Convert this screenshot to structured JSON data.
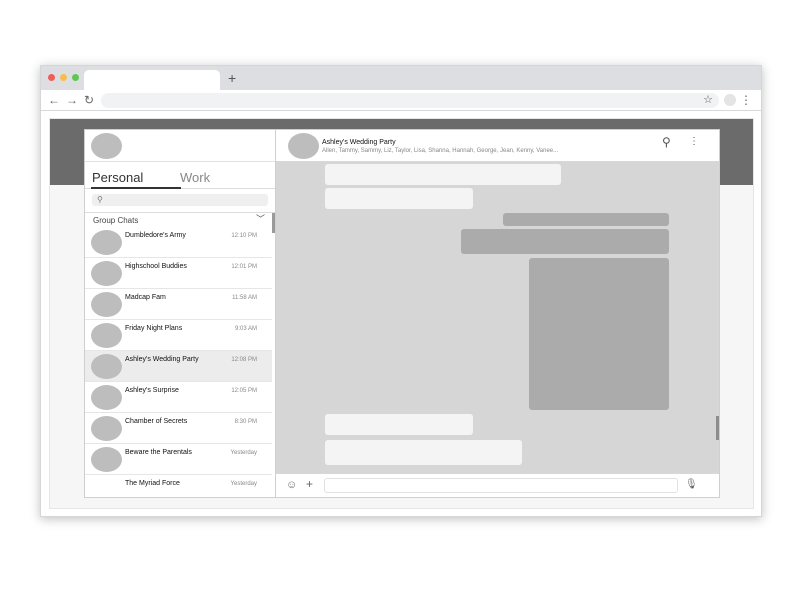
{
  "browser": {
    "dots": [
      "#ee5f57",
      "#f5bd4f",
      "#61c554"
    ],
    "new_tab": "+",
    "back": "←",
    "forward": "→",
    "reload": "↻",
    "star": "☆",
    "menu": "⋮"
  },
  "sidebar": {
    "tabs": {
      "personal": "Personal",
      "work": "Work"
    },
    "search_icon": "⚲",
    "group_label": "Group Chats",
    "chevron": "﹀",
    "chats": [
      {
        "name": "Dumbledore's Army",
        "time": "12:10 PM"
      },
      {
        "name": "Highschool Buddies",
        "time": "12:01 PM"
      },
      {
        "name": "Madcap Fam",
        "time": "11:58 AM"
      },
      {
        "name": "Friday Night Plans",
        "time": "9:03 AM"
      },
      {
        "name": "Ashley's Wedding Party",
        "time": "12:08 PM"
      },
      {
        "name": "Ashley's Surprise",
        "time": "12:05 PM"
      },
      {
        "name": "Chamber of Secrets",
        "time": "8:30 PM"
      },
      {
        "name": "Beware the Parentals",
        "time": "Yesterday"
      },
      {
        "name": "The Myriad Force",
        "time": "Yesterday"
      }
    ]
  },
  "chat": {
    "title": "Ashley's Wedding Party",
    "members": "Allen, Tammy, Sammy, Liz, Taylor, Lisa, Shanna, Hannah, George, Jean, Kenny, Vanee...",
    "search_icon": "⚲",
    "more_icon": "⋮",
    "emoji_icon": "☺",
    "add_icon": "+",
    "mic_icon": "🎙"
  }
}
